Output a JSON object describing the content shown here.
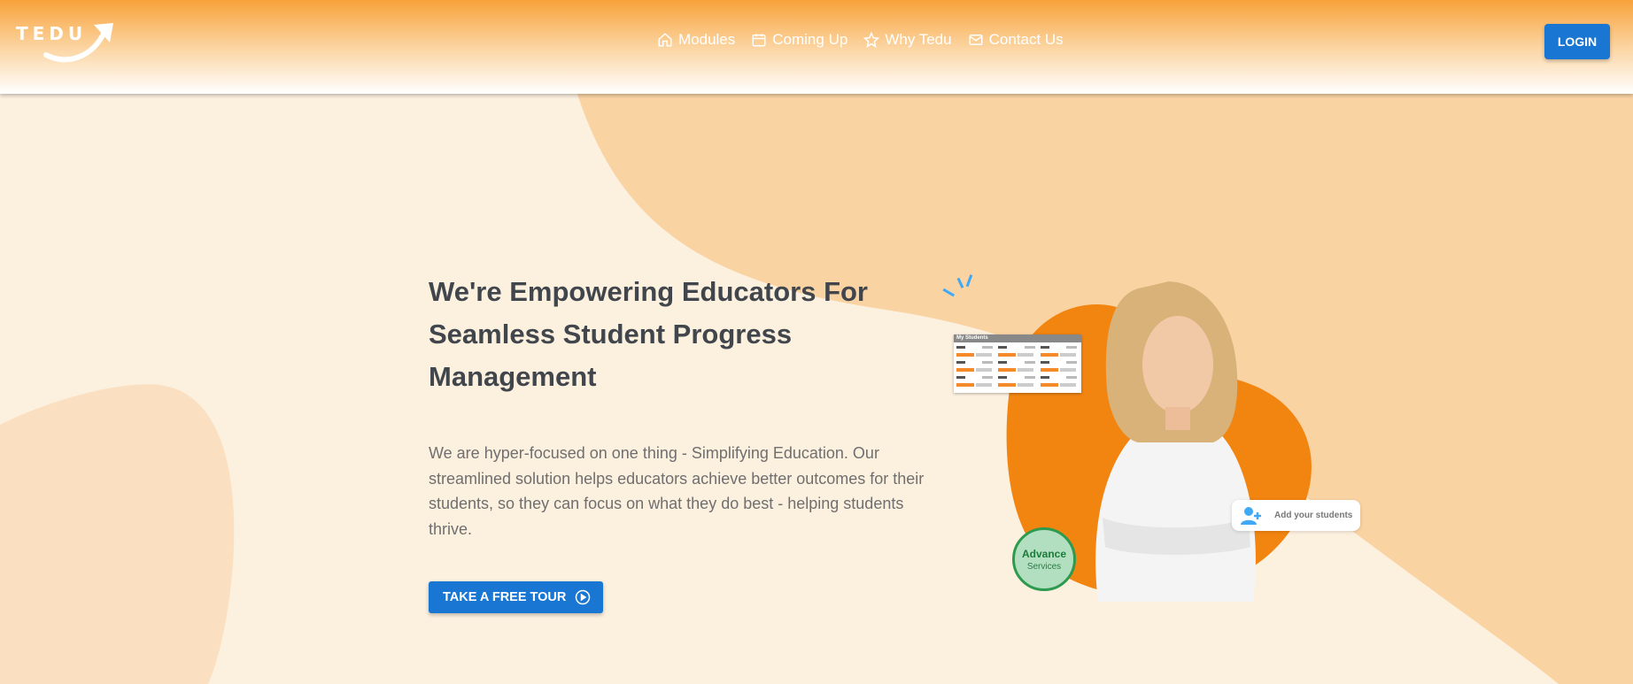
{
  "header": {
    "logo_text": "TEDU",
    "nav": [
      {
        "icon": "home-icon",
        "label": "Modules"
      },
      {
        "icon": "calendar-icon",
        "label": "Coming Up"
      },
      {
        "icon": "star-icon",
        "label": "Why Tedu"
      },
      {
        "icon": "mail-icon",
        "label": "Contact Us"
      }
    ],
    "login_label": "LOGIN"
  },
  "hero": {
    "title": "We're Empowering Educators For Seamless Student Progress Management",
    "paragraph": "We are hyper-focused on one thing - Simplifying Education. Our streamlined solution helps educators achieve better outcomes for their students, so they can focus on what they do best - helping students thrive.",
    "cta_label": "TAKE A FREE TOUR",
    "cta_icon": "play-circle-icon"
  },
  "illustration": {
    "students_card_title": "My Students",
    "add_students_label": "Add your students",
    "add_students_icon": "add-person-icon",
    "badge_title": "Advance",
    "badge_subtitle": "Services"
  },
  "colors": {
    "primary": "#1976d2",
    "header_orange": "#f8a23a",
    "background": "#fcf0df",
    "blob": "#fad3a3",
    "accent_orange": "#f57c00",
    "badge_green": "#2e9a50"
  }
}
